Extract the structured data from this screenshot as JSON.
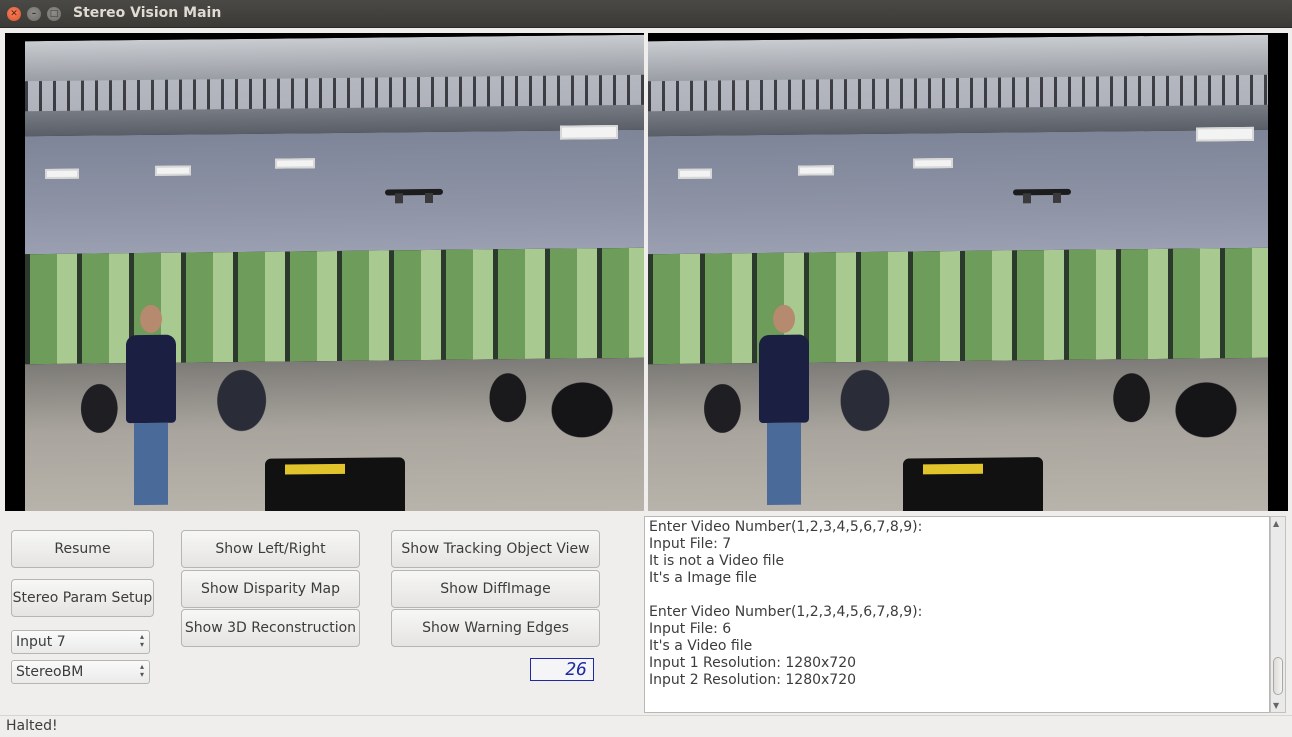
{
  "window": {
    "title": "Stereo Vision Main"
  },
  "panes": {
    "left_label": "Left camera view",
    "right_label": "Right camera view"
  },
  "controls": {
    "resume_label": "Resume",
    "stereo_param_label": "Stereo Param Setup",
    "input_select_value": "Input 7",
    "algorithm_select_value": "StereoBM",
    "show_left_right_label": "Show Left/Right",
    "show_disparity_label": "Show Disparity Map",
    "show_3d_label": "Show 3D Reconstruction",
    "show_tracking_label": "Show Tracking Object View",
    "show_diffimage_label": "Show DiffImage",
    "show_warning_edges_label": "Show Warning Edges",
    "lcd_value": "26"
  },
  "log": {
    "lines": [
      "Enter Video Number(1,2,3,4,5,6,7,8,9):",
      "Input File: 7",
      "It is not a Video file",
      "It's a Image file",
      "",
      "Enter Video Number(1,2,3,4,5,6,7,8,9):",
      "Input File: 6",
      "It's a Video file",
      "Input 1 Resolution: 1280x720",
      "Input 2 Resolution: 1280x720"
    ]
  },
  "status": {
    "text": "Halted!"
  },
  "icons": {
    "close": "close-icon",
    "minimize": "minimize-icon",
    "maximize": "maximize-icon"
  }
}
